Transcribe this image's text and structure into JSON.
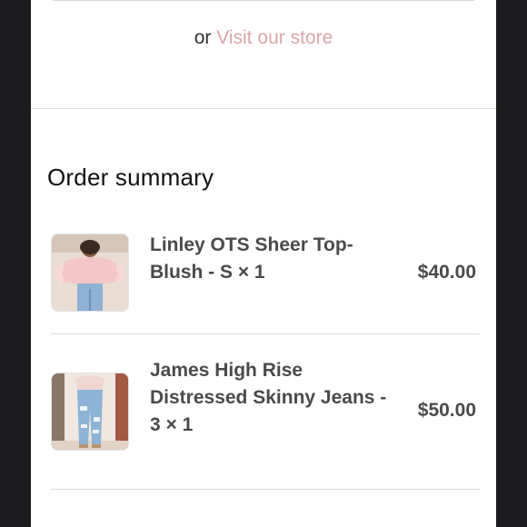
{
  "store_link": {
    "prefix": "or",
    "label": "Visit our store"
  },
  "order_summary": {
    "title": "Order summary",
    "items": [
      {
        "name": "Linley OTS Sheer Top- Blush - S × 1",
        "price": "$40.00",
        "thumbnail": "pink-off-shoulder-top-photo"
      },
      {
        "name": "James High Rise Distressed Skinny Jeans - 3 × 1",
        "price": "$50.00",
        "thumbnail": "distressed-jeans-photo"
      }
    ]
  },
  "colors": {
    "link": "#d9a5a9",
    "text": "#4a4a4a"
  }
}
